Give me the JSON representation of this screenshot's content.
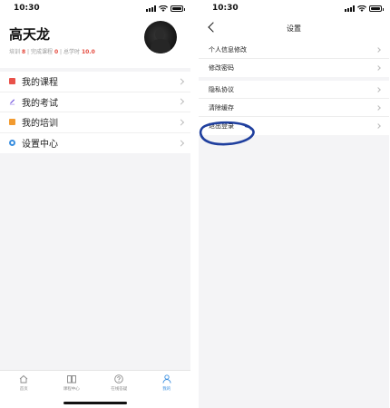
{
  "left_screen": {
    "status_time": "10:30",
    "profile": {
      "name": "高天龙",
      "stats": [
        {
          "label": "培训",
          "value": "8"
        },
        {
          "label": "完成课程",
          "value": "0"
        },
        {
          "label": "总学时",
          "value": "10.0"
        }
      ],
      "separator": "|"
    },
    "menu": [
      {
        "label": "我的课程",
        "icon": "course-icon",
        "color": "#e9524a"
      },
      {
        "label": "我的考试",
        "icon": "exam-icon",
        "color": "#7b5ee0"
      },
      {
        "label": "我的培训",
        "icon": "training-icon",
        "color": "#f29b30"
      },
      {
        "label": "设置中心",
        "icon": "settings-icon",
        "color": "#3b8fe0"
      }
    ],
    "tabs": [
      {
        "label": "首页",
        "icon": "home-icon"
      },
      {
        "label": "课程中心",
        "icon": "book-icon"
      },
      {
        "label": "在线答疑",
        "icon": "question-icon"
      },
      {
        "label": "我的",
        "icon": "user-icon",
        "active": true
      }
    ]
  },
  "right_screen": {
    "status_time": "10:30",
    "nav_title": "设置",
    "group1": [
      {
        "label": "个人信息修改"
      },
      {
        "label": "修改密码"
      }
    ],
    "group2": [
      {
        "label": "隐私协议"
      },
      {
        "label": "清除缓存"
      },
      {
        "label": "退出登录",
        "highlighted": true
      }
    ]
  },
  "colors": {
    "accent": "#3b8fe0",
    "stat_number": "#e4473b",
    "annotation": "#1f3f9e",
    "background": "#f4f4f6"
  }
}
